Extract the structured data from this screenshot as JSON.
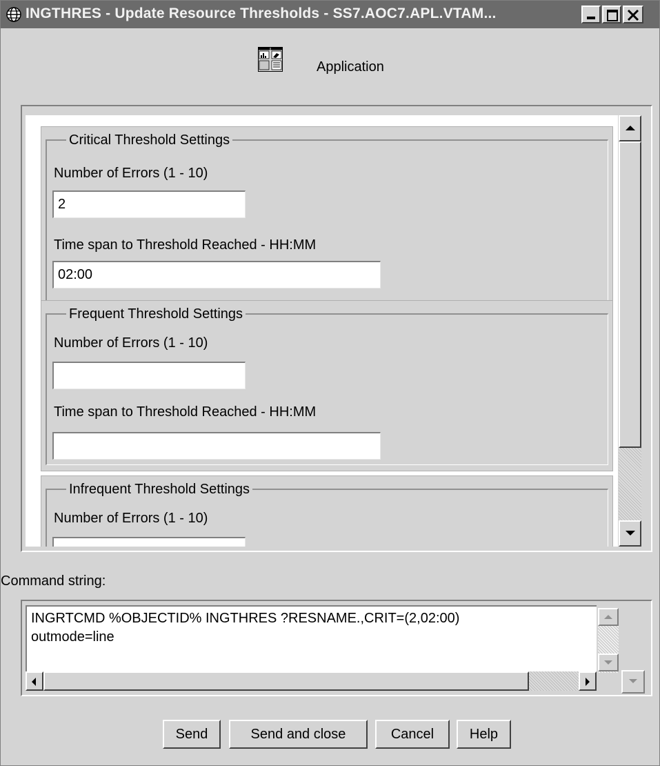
{
  "window": {
    "title": "INGTHRES - Update Resource Thresholds - SS7.AOC7.APL.VTAM...",
    "icon": "globe-icon"
  },
  "header": {
    "icon": "application-icon",
    "label": "Application"
  },
  "groups": [
    {
      "title": "Critical Threshold Settings",
      "errors_label": "Number of Errors (1 - 10)",
      "errors_value": "2",
      "timespan_label": "Time span to Threshold Reached - HH:MM",
      "timespan_value": "02:00"
    },
    {
      "title": "Frequent Threshold Settings",
      "errors_label": "Number of Errors (1 - 10)",
      "errors_value": "",
      "timespan_label": "Time span to Threshold Reached - HH:MM",
      "timespan_value": ""
    },
    {
      "title": "Infrequent Threshold Settings",
      "errors_label": "Number of Errors (1 - 10)",
      "errors_value": ""
    }
  ],
  "command": {
    "label": "Command string:",
    "line1": "INGRTCMD %OBJECTID% INGTHRES ?RESNAME.,CRIT=(2,02:00)",
    "line2": "outmode=line"
  },
  "buttons": {
    "send": "Send",
    "send_close": "Send and close",
    "cancel": "Cancel",
    "help": "Help"
  }
}
